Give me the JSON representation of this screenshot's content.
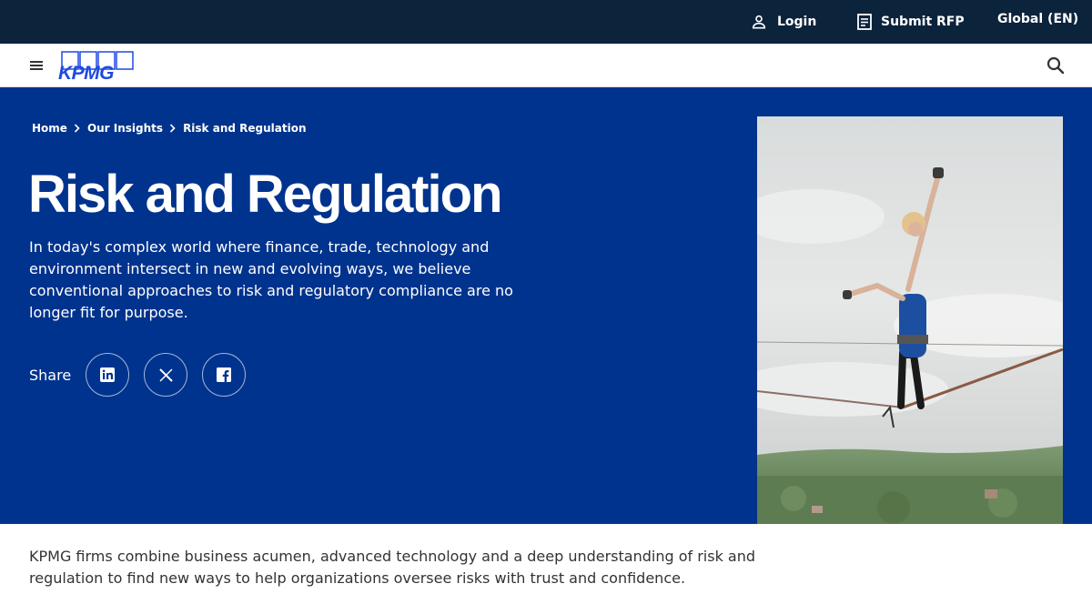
{
  "topbar": {
    "login_label": "Login",
    "submit_rfp_label": "Submit RFP",
    "global_label": "Global (EN)"
  },
  "navbar": {
    "logo_text": "KPMG"
  },
  "breadcrumb": {
    "items": [
      "Home",
      "Our Insights",
      "Risk and Regulation"
    ]
  },
  "hero": {
    "title": "Risk and Regulation",
    "description": "In today's complex world where finance, trade, technology and environment intersect in new and evolving ways, we believe conventional approaches to risk and regulatory compliance are no longer fit for purpose.",
    "share_label": "Share",
    "share_icons": [
      "linkedin-icon",
      "x-icon",
      "facebook-icon"
    ]
  },
  "intro": {
    "text": "KPMG firms combine business acumen, advanced technology and a deep understanding of risk and regulation to find new ways to help organizations oversee  risks with trust and confidence."
  },
  "colors": {
    "topbar": "#0c233c",
    "hero": "#00338d",
    "logo": "#1e49e2",
    "body_text": "#333333"
  }
}
